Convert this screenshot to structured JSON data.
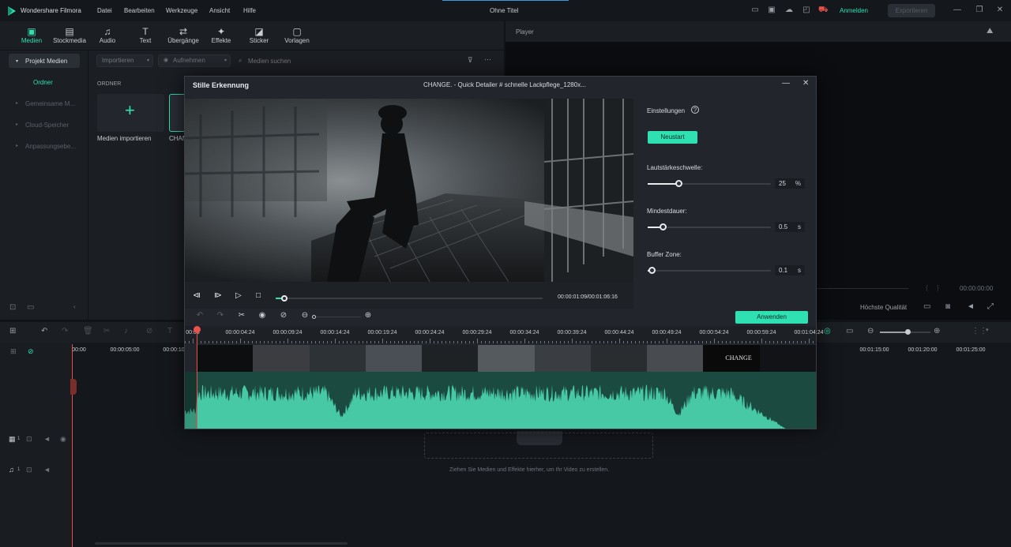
{
  "app": {
    "name": "Wondershare Filmora",
    "project_title": "Ohne Titel",
    "menu": [
      "Datei",
      "Bearbeiten",
      "Werkzeuge",
      "Ansicht",
      "Hilfe"
    ],
    "login_label": "Anmelden",
    "export_label": "Exportieren"
  },
  "toolbar": {
    "items": [
      {
        "label": "Medien",
        "icon": "media-icon"
      },
      {
        "label": "Stockmedia",
        "icon": "stockmedia-icon"
      },
      {
        "label": "Audio",
        "icon": "audio-icon"
      },
      {
        "label": "Text",
        "icon": "text-icon"
      },
      {
        "label": "Übergänge",
        "icon": "transitions-icon"
      },
      {
        "label": "Effekte",
        "icon": "effects-icon"
      },
      {
        "label": "Sticker",
        "icon": "sticker-icon"
      },
      {
        "label": "Vorlagen",
        "icon": "templates-icon"
      }
    ]
  },
  "sidebar": {
    "items": [
      "Projekt Medien",
      "Ordner",
      "Gemeinsame M...",
      "Cloud-Speicher",
      "Anpassungsebe..."
    ]
  },
  "media": {
    "import_dropdown": "Importieren",
    "record_dropdown": "Aufnehmen",
    "search_placeholder": "Medien suchen",
    "folder_heading": "ORDNER",
    "import_tile_label": "Medien importieren",
    "clip_label": "CHANG"
  },
  "player": {
    "header": "Player",
    "timecode": "00:00:00:00",
    "quality": "Höchste Qualität"
  },
  "timeline": {
    "ruler_labels": [
      "00:00",
      "00:00:05:00",
      "00:00:10",
      "00:01:15:00",
      "00:01:20:00",
      "00:01:25:00"
    ],
    "drop_hint": "Ziehen Sie Medien und Effekte hierher, um Ihr Video zu erstellen.",
    "video_track": "1",
    "audio_track": "1"
  },
  "dialog": {
    "title": "Stille Erkennung",
    "file_name": "CHANGE. - Quick Detailer # schnelle Lackpflege_1280x...",
    "settings_label": "Einstellungen",
    "restart_button": "Neustart",
    "volume_threshold_label": "Lautstärkeschwelle:",
    "volume_threshold_value": "25",
    "volume_threshold_unit": "%",
    "volume_threshold_fraction": 0.25,
    "min_duration_label": "Mindestdauer:",
    "min_duration_value": "0.5",
    "min_duration_unit": "s",
    "min_duration_fraction": 0.12,
    "buffer_zone_label": "Buffer Zone:",
    "buffer_zone_value": "0.1",
    "buffer_zone_unit": "s",
    "buffer_zone_fraction": 0.03,
    "playback_time": "00:00:01:09/00:01:06:16",
    "playback_progress": 0.03,
    "apply_button": "Anwenden",
    "ruler_labels": [
      "00:00",
      "00:00:04:24",
      "00:00:09:24",
      "00:00:14:24",
      "00:00:19:24",
      "00:00:24:24",
      "00:00:29:24",
      "00:00:34:24",
      "00:00:39:24",
      "00:00:44:24",
      "00:00:49:24",
      "00:00:54:24",
      "00:00:59:24",
      "00:01:04:24"
    ],
    "thumb_text": "CHANGE"
  },
  "colors": {
    "accent": "#2fe0b3",
    "waveform": "#48c9a5",
    "waveform_bg": "#1b4a40",
    "playhead": "#e8524a"
  }
}
